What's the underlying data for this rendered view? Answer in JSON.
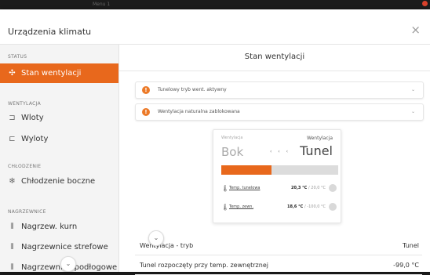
{
  "window": {
    "bg_title": "Menu 1"
  },
  "dialog": {
    "title": "Urządzenia klimatu",
    "close": "×"
  },
  "sidebar": {
    "sections": [
      {
        "label": "STATUS"
      },
      {
        "label": "WENTYLACJA"
      },
      {
        "label": "CHŁODZENIE"
      },
      {
        "label": "NAGRZEWNICE"
      }
    ],
    "items": [
      {
        "label": "Stan wentylacji",
        "icon": "fan-icon"
      },
      {
        "label": "Wloty",
        "icon": "inlet-icon"
      },
      {
        "label": "Wyloty",
        "icon": "outlet-icon"
      },
      {
        "label": "Chłodzenie boczne",
        "icon": "cooling-icon"
      },
      {
        "label": "Nagrzew. kurn",
        "icon": "heater-icon"
      },
      {
        "label": "Nagrzewnice strefowe",
        "icon": "heater-icon"
      },
      {
        "label": "Nagrzewnice podłogowe",
        "icon": "heater-icon"
      }
    ],
    "scroll_icon": "⌄"
  },
  "main": {
    "title": "Stan wentylacji",
    "alerts": [
      {
        "text": "Tunelowy tryb went. aktywny"
      },
      {
        "text": "Wentylacja naturalna zablokowana"
      }
    ],
    "card": {
      "left_label": "Wentylacja",
      "right_label": "Wentylacja",
      "left_mode": "Bok",
      "right_mode": "Tunel",
      "arrows": "‹ ‹ ‹",
      "progress": 0.43,
      "rows": [
        {
          "label": "Temp. tunelowa",
          "value": "20,3 °C",
          "target": "/ 20,0 °C"
        },
        {
          "label": "Temp. zewn.",
          "value": "18,6 °C",
          "target": "/ -100,0 °C"
        }
      ]
    },
    "table": [
      {
        "key": "Wentylacja - tryb",
        "value": "Tunel"
      },
      {
        "key": "Tunel rozpoczęty przy temp. zewnętrznej",
        "value": "-99,0 °C"
      }
    ],
    "scroll_icon": "⌄"
  },
  "colors": {
    "accent": "#e8681c",
    "warning": "#ec7a28"
  }
}
